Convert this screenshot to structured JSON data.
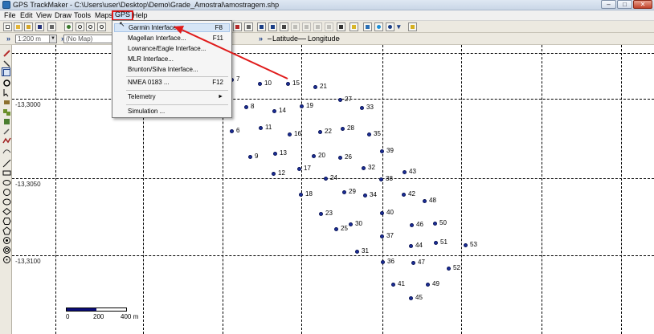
{
  "window": {
    "title": "GPS TrackMaker - C:\\Users\\user\\Desktop\\Demo\\Grade_Amostral\\amostragem.shp",
    "minimize": "–",
    "maximize": "□",
    "close": "✕"
  },
  "menubar": {
    "items": [
      "File",
      "Edit",
      "View",
      "Draw",
      "Tools",
      "Maps",
      "GPS",
      "Help"
    ],
    "active": "GPS"
  },
  "toolbar2": {
    "scale_value": "1:200 m",
    "map_value": "(No Map)",
    "latitude_label": "Latitude",
    "longitude_label": "Longitude"
  },
  "gps_menu": {
    "items": [
      {
        "label": "Garmin Interface...",
        "shortcut": "F8"
      },
      {
        "label": "Magellan Interface...",
        "shortcut": "F11"
      },
      {
        "label": "Lowrance/Eagle Interface...",
        "shortcut": ""
      },
      {
        "label": "MLR Interface...",
        "shortcut": ""
      },
      {
        "label": "Brunton/Silva Interface...",
        "shortcut": ""
      },
      {
        "label": "NMEA 0183 ...",
        "shortcut": "F12"
      },
      {
        "label": "Telemetry",
        "shortcut": ""
      },
      {
        "label": "Simulation ...",
        "shortcut": ""
      }
    ],
    "telemetry_arrow": "►",
    "cursor_glyph": "↖"
  },
  "map": {
    "lat_labels": [
      "-13,3000",
      "-13,3050",
      "-13,3100"
    ],
    "scale_labels": [
      "0",
      "200",
      "400 m"
    ],
    "waypoints": [
      "7",
      "10",
      "15",
      "21",
      "8",
      "14",
      "19",
      "27",
      "33",
      "6",
      "11",
      "16",
      "22",
      "28",
      "35",
      "9",
      "13",
      "20",
      "26",
      "39",
      "12",
      "17",
      "32",
      "43",
      "24",
      "38",
      "29",
      "34",
      "42",
      "18",
      "48",
      "23",
      "40",
      "30",
      "46",
      "50",
      "25",
      "37",
      "51",
      "44",
      "53",
      "31",
      "36",
      "47",
      "52",
      "41",
      "49",
      "45"
    ]
  },
  "colors": {
    "highlight": "#e01b1b",
    "waypoint": "#1c2f9a",
    "scale_fill": "#0b0d7a"
  }
}
